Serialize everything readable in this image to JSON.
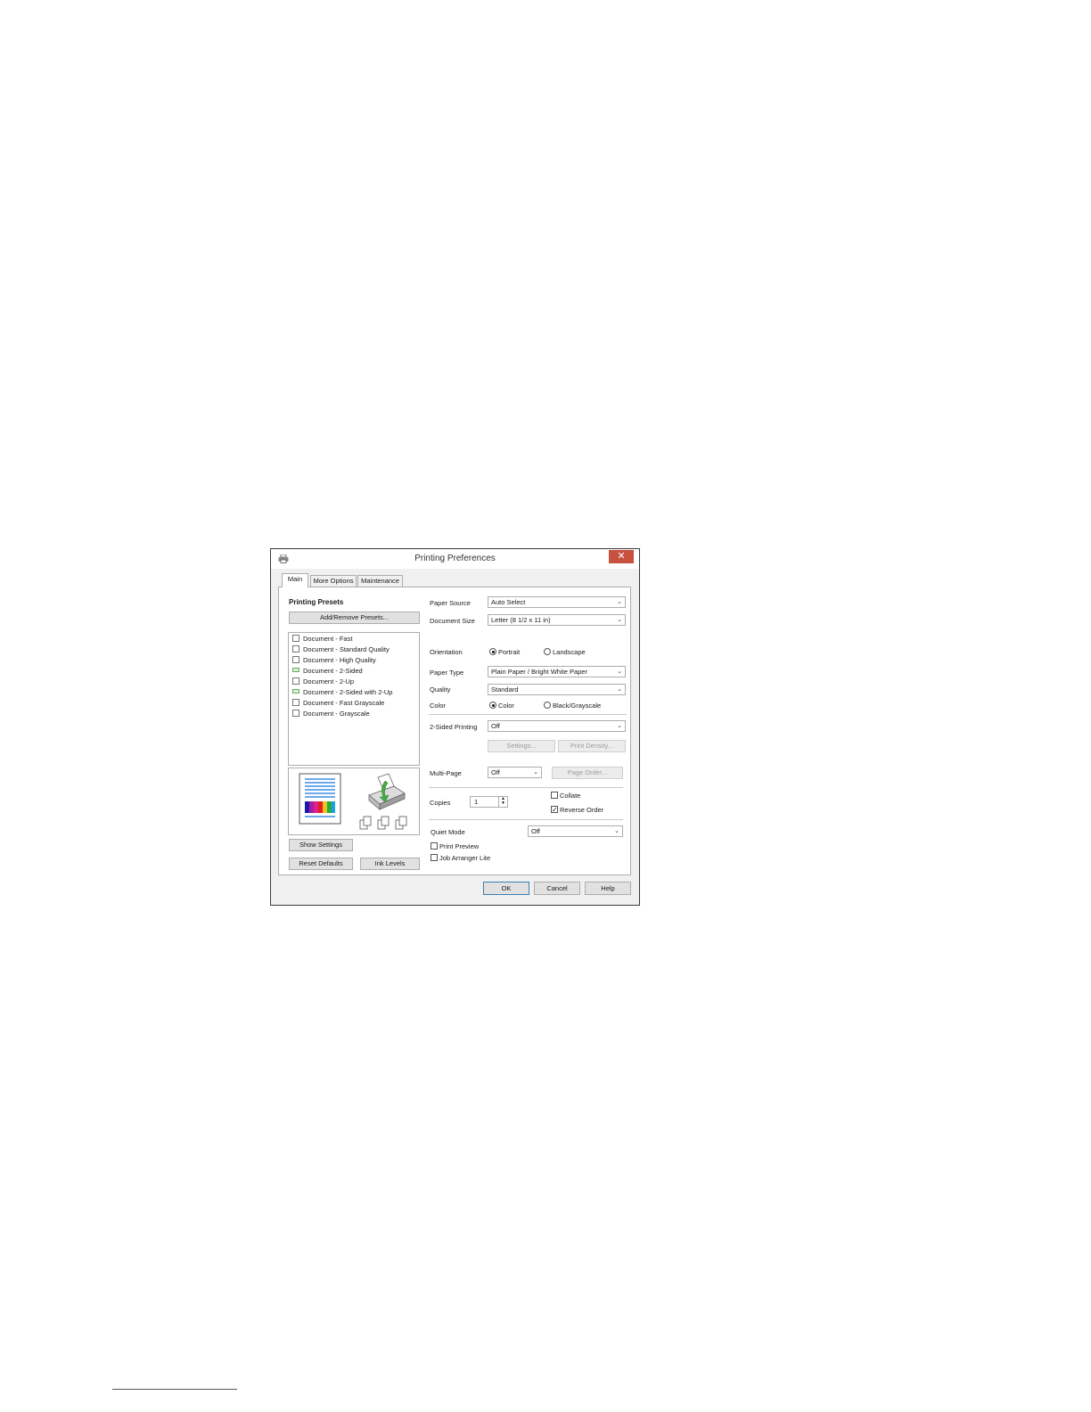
{
  "window": {
    "title": "Printing Preferences",
    "close_glyph": "✕"
  },
  "tabs": [
    {
      "label": "Main",
      "active": true
    },
    {
      "label": "More Options",
      "active": false
    },
    {
      "label": "Maintenance",
      "active": false
    }
  ],
  "presets": {
    "heading": "Printing Presets",
    "add_remove_label": "Add/Remove Presets...",
    "items": [
      {
        "label": "Document - Fast",
        "icon": "document-icon"
      },
      {
        "label": "Document - Standard Quality",
        "icon": "document-icon"
      },
      {
        "label": "Document - High Quality",
        "icon": "document-icon"
      },
      {
        "label": "Document - 2-Sided",
        "icon": "two-sided-icon"
      },
      {
        "label": "Document - 2-Up",
        "icon": "two-up-icon"
      },
      {
        "label": "Document - 2-Sided with 2-Up",
        "icon": "two-sided-icon"
      },
      {
        "label": "Document - Fast Grayscale",
        "icon": "document-icon"
      },
      {
        "label": "Document - Grayscale",
        "icon": "document-icon"
      }
    ]
  },
  "left_buttons": {
    "show_settings": "Show Settings",
    "reset_defaults": "Reset Defaults",
    "ink_levels": "Ink Levels"
  },
  "settings": {
    "paper_source": {
      "label": "Paper Source",
      "value": "Auto Select"
    },
    "document_size": {
      "label": "Document Size",
      "value": "Letter (8 1/2 x 11 in)"
    },
    "orientation": {
      "label": "Orientation",
      "portrait": "Portrait",
      "landscape": "Landscape",
      "selected": "portrait"
    },
    "paper_type": {
      "label": "Paper Type",
      "value": "Plain Paper / Bright White Paper"
    },
    "quality": {
      "label": "Quality",
      "value": "Standard"
    },
    "color": {
      "label": "Color",
      "color_option": "Color",
      "bw_option": "Black/Grayscale",
      "selected": "color"
    },
    "two_sided": {
      "label": "2-Sided Printing",
      "value": "Off",
      "settings_btn": "Settings...",
      "density_btn": "Print Density..."
    },
    "multi_page": {
      "label": "Multi-Page",
      "value": "Off",
      "page_order_btn": "Page Order..."
    },
    "copies": {
      "label": "Copies",
      "value": "1",
      "collate": "Collate",
      "collate_checked": false,
      "reverse": "Reverse Order",
      "reverse_checked": true
    },
    "quiet_mode": {
      "label": "Quiet Mode",
      "value": "Off"
    },
    "print_preview": {
      "label": "Print Preview",
      "checked": false
    },
    "job_arranger": {
      "label": "Job Arranger Lite",
      "checked": false
    }
  },
  "footer": {
    "ok": "OK",
    "cancel": "Cancel",
    "help": "Help"
  },
  "colors": {
    "close_button": "#c7503e",
    "preview_lines": "#3a8ee0",
    "printer_arrow": "#3fae3f"
  }
}
